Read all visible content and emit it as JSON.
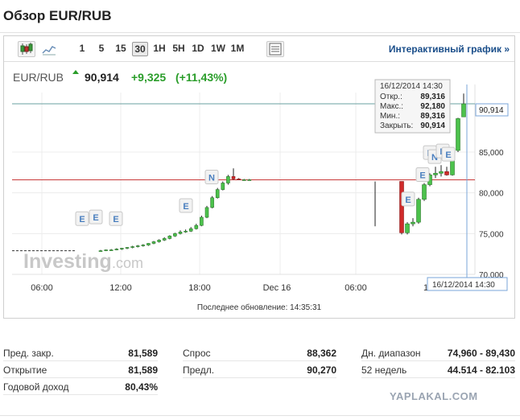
{
  "page": {
    "title": "Обзор EUR/RUB"
  },
  "toolbar": {
    "timeframes": [
      "1",
      "5",
      "15",
      "30",
      "1H",
      "5H",
      "1D",
      "1W",
      "1M"
    ],
    "active_timeframe": "30",
    "icons": [
      "candlestick-icon",
      "line-chart-icon",
      "table-icon"
    ],
    "interactive_link": "Интерактивный график »"
  },
  "quote": {
    "symbol": "EUR/RUB",
    "price": "90,914",
    "change": "+9,325",
    "change_pct": "(+11,43%)",
    "up_color": "#2a9d2a"
  },
  "tooltip": {
    "datetime": "16/12/2014 14:30",
    "rows": [
      {
        "label": "Откр.:",
        "value": "89,316"
      },
      {
        "label": "Макс.:",
        "value": "92,180"
      },
      {
        "label": "Мин.:",
        "value": "89,316"
      },
      {
        "label": "Закрыть:",
        "value": "90,914"
      }
    ]
  },
  "price_label": "90,914",
  "crosshair_label": "16/12/2014 14:30",
  "updated_text": "Последнее обновление: 14:35:31",
  "logo": {
    "text_main": "Investing",
    "text_suffix": ".com"
  },
  "chart_data": {
    "type": "candlestick",
    "x_tick_labels": [
      "06:00",
      "12:00",
      "18:00",
      "Dec 16",
      "06:00",
      "1"
    ],
    "y_tick_labels": [
      "90,914",
      "85,000",
      "80,000",
      "75,000",
      "70,000"
    ],
    "ylim": [
      70,
      92.3
    ],
    "prev_close_line": 81.589,
    "current_price_line": 90.914,
    "event_marker_labels": [
      "E",
      "E",
      "E",
      "E",
      "N",
      "E",
      "E",
      "E",
      "N",
      "E",
      "E"
    ],
    "day1_candles": [
      [
        72.9,
        73.0,
        72.8,
        72.9
      ],
      [
        72.9,
        73.05,
        72.85,
        73.0
      ],
      [
        73.0,
        73.1,
        72.9,
        73.0
      ],
      [
        73.0,
        73.2,
        72.95,
        73.1
      ],
      [
        73.1,
        73.25,
        73.0,
        73.2
      ],
      [
        73.2,
        73.35,
        73.1,
        73.3
      ],
      [
        73.3,
        73.5,
        73.2,
        73.4
      ],
      [
        73.4,
        73.6,
        73.3,
        73.5
      ],
      [
        73.5,
        73.7,
        73.4,
        73.6
      ],
      [
        73.6,
        73.85,
        73.5,
        73.8
      ],
      [
        73.8,
        74.1,
        73.7,
        74.0
      ],
      [
        74.0,
        74.3,
        73.9,
        74.2
      ],
      [
        74.2,
        74.55,
        74.1,
        74.4
      ],
      [
        74.4,
        74.8,
        74.3,
        74.7
      ],
      [
        74.7,
        75.1,
        74.6,
        75.0
      ],
      [
        75.0,
        75.4,
        74.9,
        75.2
      ],
      [
        75.2,
        75.5,
        75.1,
        75.3
      ],
      [
        75.3,
        75.8,
        75.2,
        75.6
      ],
      [
        75.6,
        76.2,
        75.5,
        76.0
      ],
      [
        76.0,
        77.2,
        75.9,
        77.0
      ],
      [
        77.0,
        78.4,
        76.9,
        78.2
      ],
      [
        78.2,
        79.6,
        78.1,
        79.4
      ],
      [
        79.4,
        80.6,
        79.3,
        80.4
      ],
      [
        80.4,
        81.4,
        80.3,
        81.2
      ],
      [
        81.2,
        82.2,
        81.0,
        82.0
      ],
      [
        82.0,
        83.0,
        81.6,
        81.7
      ],
      [
        81.7,
        81.8,
        81.6,
        81.6
      ],
      [
        81.6,
        81.7,
        81.5,
        81.6
      ],
      [
        81.6,
        81.7,
        81.5,
        81.6
      ]
    ],
    "day2_candles": [
      [
        81.4,
        81.4,
        75.9,
        75.9
      ],
      [
        81.4,
        81.4,
        74.9,
        75.1
      ],
      [
        75.1,
        76.4,
        74.9,
        76.2
      ],
      [
        76.2,
        76.9,
        75.9,
        76.4
      ],
      [
        76.4,
        79.4,
        76.2,
        79.2
      ],
      [
        79.2,
        81.2,
        79.0,
        81.0
      ],
      [
        81.0,
        82.4,
        80.8,
        82.2
      ],
      [
        82.2,
        83.2,
        81.8,
        82.4
      ],
      [
        82.4,
        83.4,
        82.0,
        82.6
      ],
      [
        82.6,
        83.2,
        82.1,
        82.2
      ],
      [
        82.2,
        85.4,
        82.1,
        85.2
      ],
      [
        85.2,
        89.2,
        85.0,
        89.1
      ],
      [
        89.316,
        92.18,
        89.316,
        90.914
      ]
    ]
  },
  "stats": [
    {
      "label": "Пред. закр.",
      "value": "81,589"
    },
    {
      "label": "Открытие",
      "value": "81,589"
    },
    {
      "label": "Годовой доход",
      "value": "80,43%"
    },
    {
      "label": "Спрос",
      "value": "88,362"
    },
    {
      "label": "Предл.",
      "value": "90,270"
    },
    {
      "label": "Дн. диапазон",
      "value": "74,960 - 89,430"
    },
    {
      "label": "52 недель",
      "value": "44.514 - 82.103"
    }
  ],
  "watermark": "YAPLAKAL.COM"
}
